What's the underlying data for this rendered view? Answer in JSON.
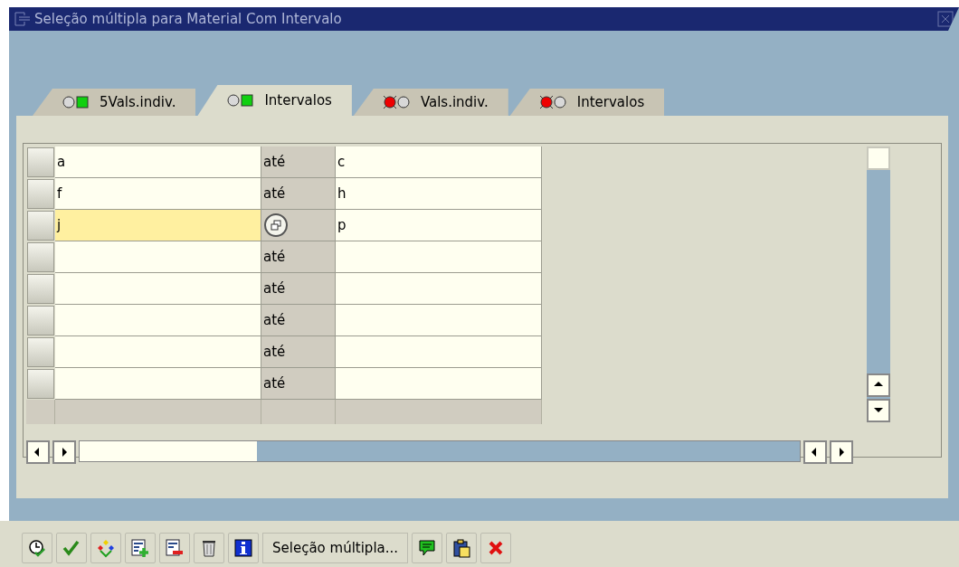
{
  "window": {
    "title": "Seleção múltipla para Material Com Intervalo"
  },
  "tabs": [
    {
      "label": "5Vals.indiv.",
      "selected": false,
      "kind": "ok"
    },
    {
      "label": "Intervalos",
      "selected": true,
      "kind": "ok"
    },
    {
      "label": "Vals.indiv.",
      "selected": false,
      "kind": "error"
    },
    {
      "label": "Intervalos",
      "selected": false,
      "kind": "error"
    }
  ],
  "table": {
    "rows": [
      {
        "kind": "text",
        "low": "a",
        "option": "até",
        "high": "c",
        "focused": false
      },
      {
        "kind": "text",
        "low": "f",
        "option": "até",
        "high": "h",
        "focused": false
      },
      {
        "kind": "icon",
        "low": "j",
        "high": "p",
        "focused": true
      },
      {
        "kind": "text",
        "option": "até",
        "focused": false
      },
      {
        "kind": "text",
        "option": "até",
        "focused": false
      },
      {
        "kind": "text",
        "option": "até",
        "focused": false
      },
      {
        "kind": "text",
        "option": "até",
        "focused": false
      },
      {
        "kind": "text",
        "option": "até",
        "focused": false
      }
    ]
  },
  "toolbar": {
    "button_label": "Seleção múltipla..."
  }
}
